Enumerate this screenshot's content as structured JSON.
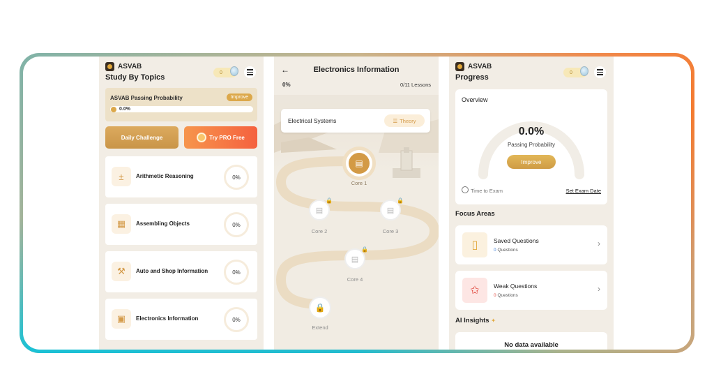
{
  "screen1": {
    "brand": "ASVAB",
    "title": "Study By Topics",
    "coins": "0",
    "probability": {
      "label": "ASVAB Passing Probability",
      "improve": "Improve",
      "value": "0.0%"
    },
    "daily_challenge": "Daily Challenge",
    "try_pro": "Try PRO Free",
    "topics": [
      {
        "name": "Arithmetic Reasoning",
        "progress": "0%"
      },
      {
        "name": "Assembling Objects",
        "progress": "0%"
      },
      {
        "name": "Auto and Shop Information",
        "progress": "0%"
      },
      {
        "name": "Electronics Information",
        "progress": "0%"
      }
    ]
  },
  "screen2": {
    "title": "Electronics Information",
    "progress": "0%",
    "lessons": "0/11 Lessons",
    "unit_name": "Electrical Systems",
    "theory": "Theory",
    "nodes": [
      {
        "label": "Core 1"
      },
      {
        "label": "Core 2"
      },
      {
        "label": "Core 3"
      },
      {
        "label": "Core 4"
      },
      {
        "label": "Extend"
      }
    ]
  },
  "screen3": {
    "brand": "ASVAB",
    "title": "Progress",
    "coins": "0",
    "overview": {
      "heading": "Overview",
      "value": "0.0%",
      "label": "Passing Probability",
      "improve": "Improve",
      "time_to_exam": "Time to Exam",
      "set_exam_date": "Set Exam Date"
    },
    "focus_title": "Focus Areas",
    "focus": [
      {
        "name": "Saved Questions",
        "count": "0",
        "unit": "Questions",
        "count_color": "#3a7bd5"
      },
      {
        "name": "Weak Questions",
        "count": "0",
        "unit": "Questions",
        "count_color": "#e0453a"
      }
    ],
    "ai_title": "AI Insights",
    "no_data": "No data available"
  },
  "colors": {
    "accent": "#dca84a",
    "pro_gradient_start": "#f6954c",
    "pro_gradient_end": "#f5613f",
    "screen_bg": "#f2ede5"
  }
}
